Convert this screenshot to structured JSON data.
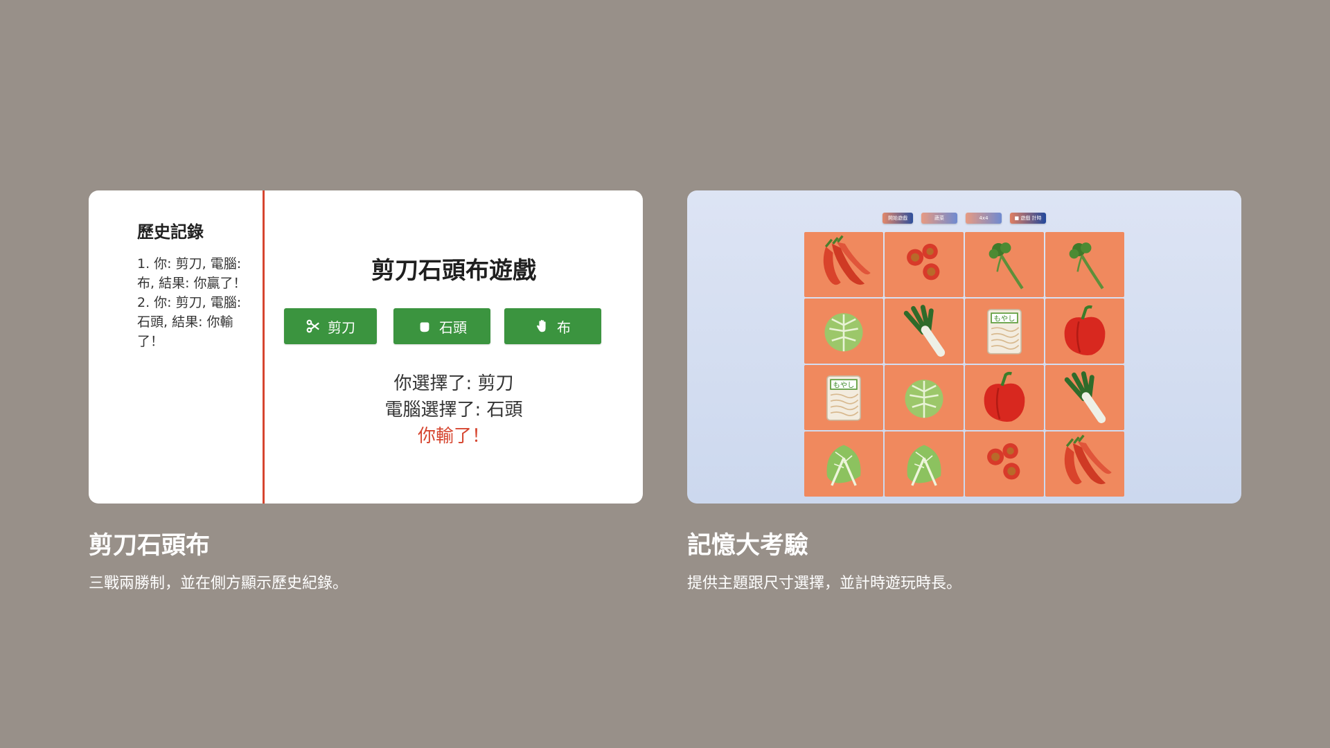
{
  "cards": [
    {
      "title": "剪刀石頭布",
      "description": "三戰兩勝制，並在側方顯示歷史紀錄。",
      "preview": {
        "history_title": "歷史記錄",
        "history": [
          "1. 你: 剪刀, 電腦: 布, 結果: 你贏了！",
          "2. 你: 剪刀, 電腦: 石頭, 結果: 你輸了！"
        ],
        "game_title": "剪刀石頭布遊戲",
        "buttons": [
          {
            "label": "剪刀",
            "icon": "scissors-icon"
          },
          {
            "label": "石頭",
            "icon": "fist-icon"
          },
          {
            "label": "布",
            "icon": "hand-icon"
          }
        ],
        "player_choice": "你選擇了: 剪刀",
        "computer_choice": "電腦選擇了: 石頭",
        "outcome": "你輸了！",
        "accent_color": "#d6452f",
        "button_color": "#3b943f"
      }
    },
    {
      "title": "記憶大考驗",
      "description": "提供主題跟尺寸選擇，並計時遊玩時長。",
      "preview": {
        "toolbar": [
          "開始遊戲",
          "蔬菜",
          "4x4",
          "■ 遊戲 計時"
        ],
        "tile_color": "#f0895e",
        "tiles": [
          "chili-pepper-icon",
          "cherry-tomato-icon",
          "broccoli-icon",
          "broccoli-icon",
          "cabbage-icon",
          "leek-icon",
          "bean-sprouts-icon",
          "red-bell-pepper-icon",
          "bean-sprouts-icon",
          "cabbage-icon",
          "red-bell-pepper-icon",
          "leek-icon",
          "lettuce-icon",
          "lettuce-icon",
          "cherry-tomato-icon",
          "chili-pepper-icon"
        ],
        "sprouts_label": "もやし"
      }
    }
  ],
  "page_background": "#989089"
}
